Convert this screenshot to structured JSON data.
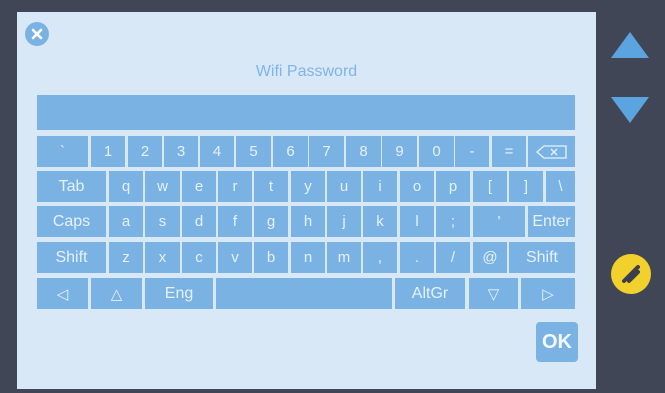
{
  "title": "Wifi Password",
  "password_value": "",
  "ok_label": "OK",
  "icons": {
    "close": "close-icon",
    "scroll_up": "triangle-up-icon",
    "scroll_down": "triangle-down-icon",
    "settings": "wrench-icon"
  },
  "colors": {
    "frame": "#404656",
    "screen": "#d9e8f7",
    "key": "#7ab3e3",
    "key_text": "#e6f1fb",
    "title": "#7fb4e6",
    "settings": "#f3d12c"
  },
  "keyboard": {
    "rows": [
      [
        {
          "label": "`"
        },
        {
          "label": "1"
        },
        {
          "label": "2"
        },
        {
          "label": "3"
        },
        {
          "label": "4"
        },
        {
          "label": "5"
        },
        {
          "label": "6"
        },
        {
          "label": "7"
        },
        {
          "label": "8"
        },
        {
          "label": "9"
        },
        {
          "label": "0"
        },
        {
          "label": "-"
        },
        {
          "label": "="
        },
        {
          "label": "",
          "icon": "backspace-icon"
        }
      ],
      [
        {
          "label": "Tab"
        },
        {
          "label": "q"
        },
        {
          "label": "w"
        },
        {
          "label": "e"
        },
        {
          "label": "r"
        },
        {
          "label": "t"
        },
        {
          "label": "y"
        },
        {
          "label": "u"
        },
        {
          "label": "i"
        },
        {
          "label": "o"
        },
        {
          "label": "p"
        },
        {
          "label": "["
        },
        {
          "label": "]"
        },
        {
          "label": "\\"
        }
      ],
      [
        {
          "label": "Caps"
        },
        {
          "label": "a"
        },
        {
          "label": "s"
        },
        {
          "label": "d"
        },
        {
          "label": "f"
        },
        {
          "label": "g"
        },
        {
          "label": "h"
        },
        {
          "label": "j"
        },
        {
          "label": "k"
        },
        {
          "label": "l"
        },
        {
          "label": ";"
        },
        {
          "label": "'"
        },
        {
          "label": "Enter"
        }
      ],
      [
        {
          "label": "Shift"
        },
        {
          "label": "z"
        },
        {
          "label": "x"
        },
        {
          "label": "c"
        },
        {
          "label": "v"
        },
        {
          "label": "b"
        },
        {
          "label": "n"
        },
        {
          "label": "m"
        },
        {
          "label": ","
        },
        {
          "label": "."
        },
        {
          "label": "/"
        },
        {
          "label": "@"
        },
        {
          "label": "Shift"
        }
      ],
      [
        {
          "label": "◁",
          "icon": "arrow-left-icon"
        },
        {
          "label": "△",
          "icon": "arrow-up-icon"
        },
        {
          "label": "Eng"
        },
        {
          "label": "",
          "icon": "space-key"
        },
        {
          "label": "AltGr"
        },
        {
          "label": "▽",
          "icon": "arrow-down-icon"
        },
        {
          "label": "▷",
          "icon": "arrow-right-icon"
        }
      ]
    ]
  }
}
